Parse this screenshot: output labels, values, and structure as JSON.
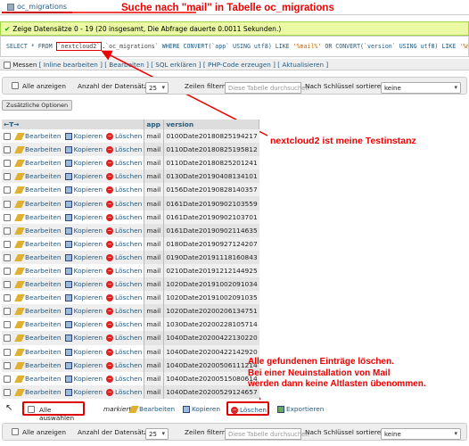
{
  "tab": {
    "label": "oc_migrations"
  },
  "annotations": {
    "search": "Suche nach \"mail\" in Tabelle oc_migrations",
    "instance": "nextcloud2 ist meine Testinstanz",
    "delete_line1": "Alle gefundenen Einträge löschen.",
    "delete_line2": "Bei einer Neuinstallation von Mail",
    "delete_line3": "werden dann keine Altlasten übenommen."
  },
  "success": {
    "text": "Zeige Datensätze 0 - 19 (20 insgesamt, Die Abfrage dauerte 0.0011 Sekunden.)"
  },
  "sql": {
    "p1": "SELECT * FROM ",
    "db": "`nextcloud2`",
    "p2": ".",
    "tbl": "`oc_migrations`",
    "p3": " WHERE CONVERT(`app` USING utf8) LIKE ",
    "s1": "'%mail%'",
    "p4": " OR CONVERT(`version` USING utf8) LIKE ",
    "s2": "'%mail%'"
  },
  "links": {
    "messen": "Messen",
    "inline": "[ Inline bearbeiten ]",
    "edit": "[ Bearbeiten ]",
    "explain": "[ SQL erklären ]",
    "php": "[ PHP-Code erzeugen ]",
    "refresh": "[ Aktualisieren ]"
  },
  "controls": {
    "show_all": "Alle anzeigen",
    "rows_label": "Anzahl der Datensätze:",
    "rows_value": "25",
    "filter_label": "Zeilen filtern:",
    "filter_placeholder": "Diese Tabelle durchsuchen",
    "sort_label": "Nach Schlüssel sortieren:",
    "sort_value": "keine"
  },
  "extra_options": "Zusätzliche Optionen",
  "table": {
    "nav": "←T→",
    "col_app": "app",
    "col_version": "version",
    "edit": "Bearbeiten",
    "copy": "Kopieren",
    "delete": "Löschen",
    "rows": [
      {
        "app": "mail",
        "version": "0100Date20180825194217"
      },
      {
        "app": "mail",
        "version": "0110Date20180825195812"
      },
      {
        "app": "mail",
        "version": "0110Date20180825201241"
      },
      {
        "app": "mail",
        "version": "0130Date20190408134101"
      },
      {
        "app": "mail",
        "version": "0156Date20190828140357"
      },
      {
        "app": "mail",
        "version": "0161Date20190902103559"
      },
      {
        "app": "mail",
        "version": "0161Date20190902103701"
      },
      {
        "app": "mail",
        "version": "0161Date20190902114635"
      },
      {
        "app": "mail",
        "version": "0180Date20190927124207"
      },
      {
        "app": "mail",
        "version": "0190Date20191118160843"
      },
      {
        "app": "mail",
        "version": "0210Date20191212144925"
      },
      {
        "app": "mail",
        "version": "1020Date20191002091034"
      },
      {
        "app": "mail",
        "version": "1020Date20191002091035"
      },
      {
        "app": "mail",
        "version": "1020Date20200206134751"
      },
      {
        "app": "mail",
        "version": "1030Date20200228105714"
      },
      {
        "app": "mail",
        "version": "1040Date20200422130220"
      },
      {
        "app": "mail",
        "version": "1040Date20200422142920"
      },
      {
        "app": "mail",
        "version": "1040Date20200506111214"
      },
      {
        "app": "mail",
        "version": "1040Date20200515080614"
      },
      {
        "app": "mail",
        "version": "1040Date20200529124657"
      }
    ]
  },
  "bottom": {
    "select_all": "Alle auswählen",
    "marked": "markierte:",
    "edit": "Bearbeiten",
    "copy": "Kopieren",
    "delete": "Löschen",
    "export": "Exportieren"
  },
  "colors": {
    "annotation": "#e00000",
    "link": "#235a81",
    "success_bg": "#ebf8a4"
  }
}
